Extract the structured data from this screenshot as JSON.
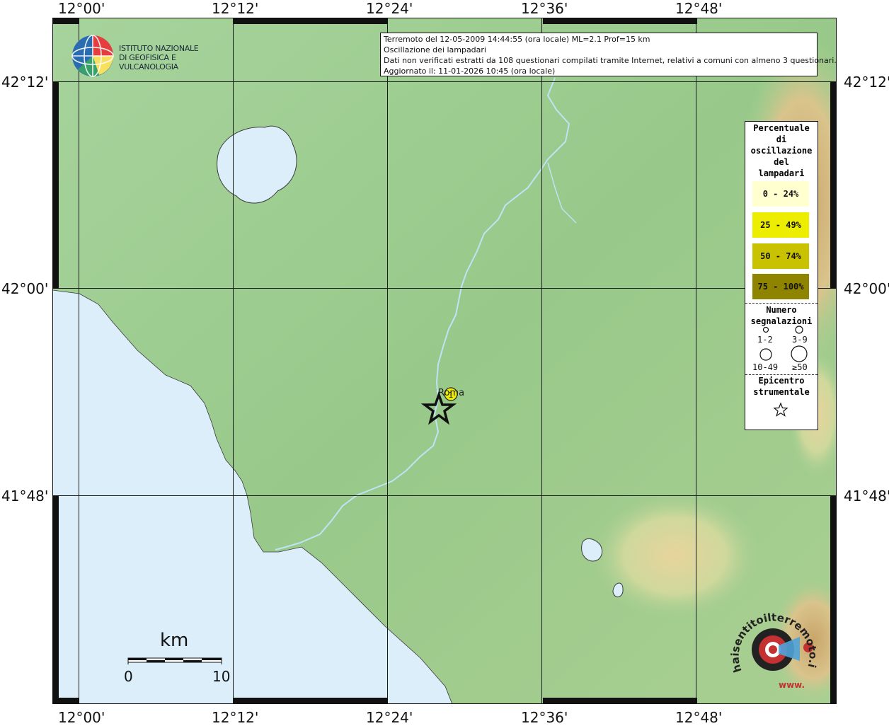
{
  "lon_ticks": [
    "12°00'",
    "12°12'",
    "12°24'",
    "12°36'",
    "12°48'"
  ],
  "lat_ticks": [
    "42°12'",
    "42°00'",
    "41°48'"
  ],
  "info": {
    "line1": "Terremoto del 12-05-2009 14:44:55 (ora locale) ML=2.1 Prof=15 km",
    "line2": "Oscillazione dei lampadari",
    "line3": "Dati non verificati estratti da 108 questionari compilati tramite Internet, relativi a comuni con almeno 3 questionari.",
    "line4": "Aggiornato il: 11-01-2026 10:45 (ora locale)"
  },
  "ingv": {
    "line1": "ISTITUTO NAZIONALE",
    "line2": "DI GEOFISICA E VULCANOLOGIA"
  },
  "legend": {
    "title": [
      "Percentuale",
      "di",
      "oscillazione",
      "del",
      "lampadari"
    ],
    "classes": [
      {
        "label": "0 - 24%",
        "color": "#ffffd0"
      },
      {
        "label": "25 - 49%",
        "color": "#eded00"
      },
      {
        "label": "50 - 74%",
        "color": "#c9c200"
      },
      {
        "label": "75 - 100%",
        "color": "#8f8400"
      }
    ],
    "count_title": [
      "Numero",
      "segnalazioni"
    ],
    "count_labels": [
      "1-2",
      "3-9",
      "10-49",
      "≥50"
    ],
    "epi_title": [
      "Epicentro",
      "strumentale"
    ]
  },
  "city": {
    "name": "Roma",
    "count_label": "1",
    "class_color": "#eded00"
  },
  "scale": {
    "unit": "km",
    "min": "0",
    "max": "10"
  },
  "logo": {
    "text": "haisentitoilterremoto.it",
    "prefix": "www."
  },
  "colors": {
    "sea": "#dbeefa",
    "land": "#9fcc90",
    "relief": "#c8b07a",
    "river": "#bfe3f5"
  }
}
